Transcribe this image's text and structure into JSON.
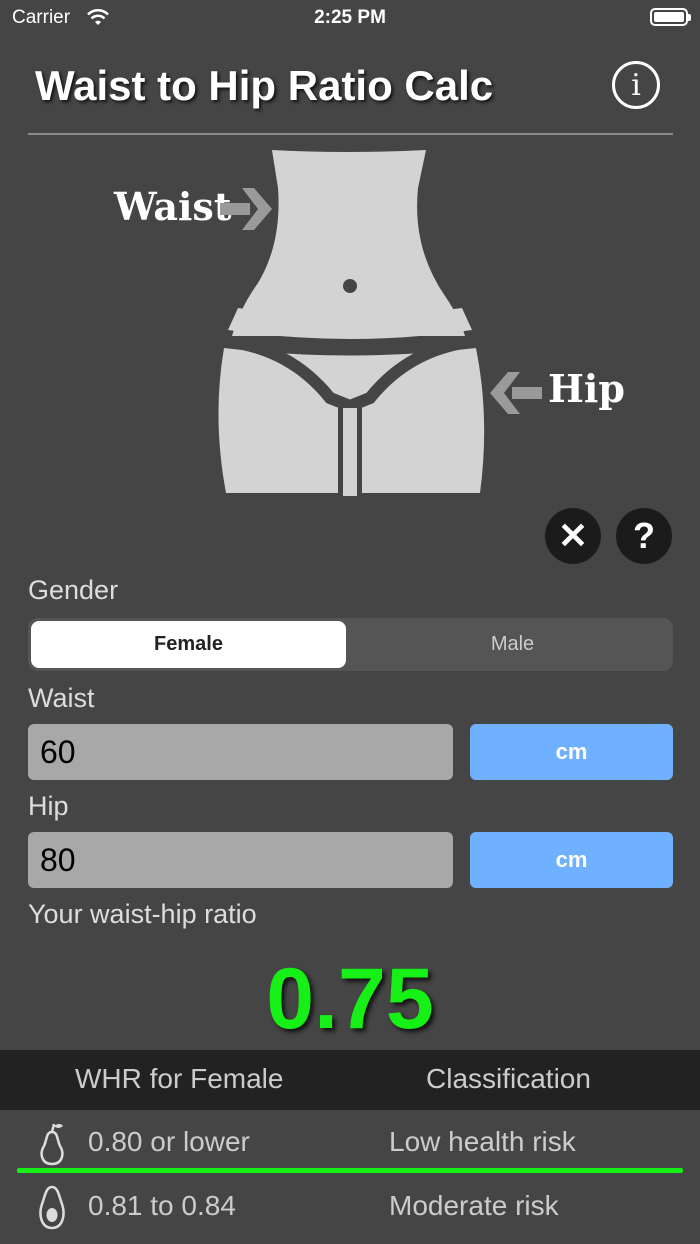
{
  "status_bar": {
    "carrier": "Carrier",
    "time": "2:25 PM"
  },
  "header": {
    "title": "Waist to Hip Ratio Calc",
    "info_icon": "i"
  },
  "figure": {
    "waist_label": "Waist",
    "hip_label": "Hip"
  },
  "actions": {
    "clear_icon": "✕",
    "help_icon": "?"
  },
  "gender": {
    "label": "Gender",
    "options": [
      "Female",
      "Male"
    ],
    "selected": "Female"
  },
  "waist": {
    "label": "Waist",
    "value": "60",
    "unit": "cm"
  },
  "hip": {
    "label": "Hip",
    "value": "80",
    "unit": "cm"
  },
  "result": {
    "label": "Your waist-hip ratio",
    "value": "0.75",
    "color": "#16f016"
  },
  "table": {
    "headers": [
      "WHR for Female",
      "Classification"
    ],
    "rows": [
      {
        "icon": "pear-icon",
        "range": "0.80 or lower",
        "classification": "Low health risk",
        "highlighted": true
      },
      {
        "icon": "avocado-icon",
        "range": "0.81 to 0.84",
        "classification": "Moderate risk",
        "highlighted": false
      }
    ]
  },
  "colors": {
    "accent_blue": "#6fb1ff",
    "result_green": "#16f016",
    "background": "#454545"
  }
}
